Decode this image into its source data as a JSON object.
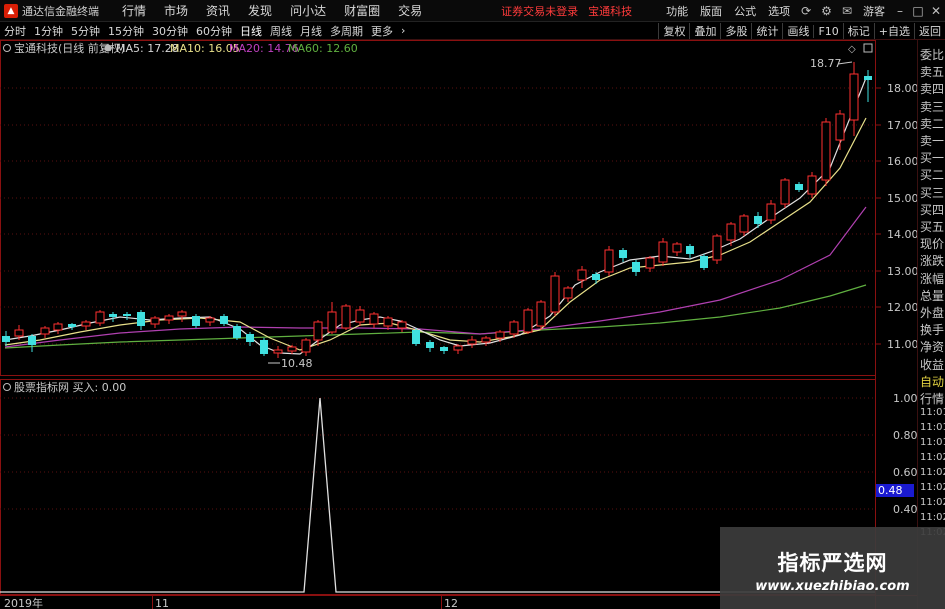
{
  "app": {
    "title": "通达信金融终端",
    "menu": [
      "行情",
      "市场",
      "资讯",
      "发现",
      "问小达",
      "财富圈",
      "交易"
    ],
    "login_status": "证券交易未登录",
    "login_stock": "宝通科技",
    "right_menu": [
      "功能",
      "版面",
      "公式",
      "选项"
    ],
    "guest_label": "游客"
  },
  "toolbar": {
    "periods": [
      "分时",
      "1分钟",
      "5分钟",
      "15分钟",
      "30分钟",
      "60分钟",
      "日线",
      "周线",
      "月线",
      "多周期",
      "更多"
    ],
    "active_period": "日线",
    "buttons": [
      "复权",
      "叠加",
      "多股",
      "统计",
      "画线",
      "F10",
      "标记",
      "+自选",
      "返回"
    ]
  },
  "main_chart": {
    "header": "宝通科技(日线 前复权)",
    "ma": [
      {
        "label": "MA5: 17.28",
        "color": "#d8d8d8"
      },
      {
        "label": "MA10: 16.05",
        "color": "#e8e08a"
      },
      {
        "label": "MA20: 14.76",
        "color": "#c040c0"
      },
      {
        "label": "MA60: 12.60",
        "color": "#60b040"
      }
    ],
    "y_labels": [
      "18.00",
      "17.00",
      "16.00",
      "15.00",
      "14.00",
      "13.00",
      "12.00",
      "11.00"
    ],
    "high_label": "18.77",
    "low_label": "10.48",
    "indicator_colors": {
      "up": "#ff3030",
      "down": "#40e0e0"
    }
  },
  "sub_chart": {
    "header": "股票指标网  买入: 0.00",
    "y_labels": [
      "1.00",
      "0.80",
      "0.60",
      "0.48",
      "0.40"
    ],
    "current_value": "0.48",
    "signal": [
      {
        "x": "2019-11-18",
        "value": 0
      },
      {
        "x": "2019-11-19",
        "value": 1.0
      },
      {
        "x": "2019-11-20",
        "value": 0
      }
    ]
  },
  "x_axis": [
    "2019年",
    "11",
    "12"
  ],
  "right_panel": {
    "items": [
      "委比",
      "卖五",
      "卖四",
      "卖三",
      "卖二",
      "卖一",
      "买一",
      "买二",
      "买三",
      "买四",
      "买五",
      "现价",
      "涨跌",
      "涨幅",
      "总量",
      "外盘",
      "换手",
      "净资",
      "收益",
      "自动",
      "行情",
      "11:01",
      "11:01",
      "11:01",
      "11:02",
      "11:02",
      "11:02",
      "11:02",
      "11:02",
      "11:02"
    ]
  },
  "watermark": {
    "title": "指标严选网",
    "url": "www.xuezhibiao.com"
  }
}
